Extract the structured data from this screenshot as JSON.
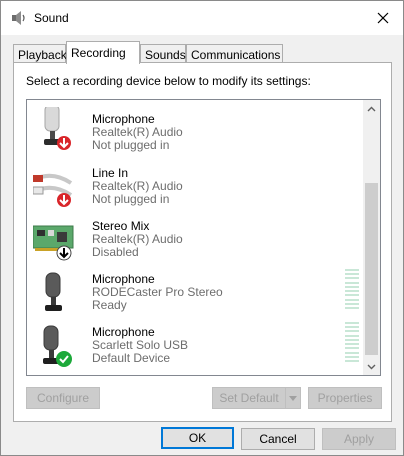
{
  "window": {
    "title": "Sound",
    "title_icon": "speaker-icon",
    "close_icon": "close-icon"
  },
  "tabs": [
    {
      "label": "Playback",
      "active": false
    },
    {
      "label": "Recording",
      "active": true
    },
    {
      "label": "Sounds",
      "active": false
    },
    {
      "label": "Communications",
      "active": false
    }
  ],
  "instruction": "Select a recording device below to modify its settings:",
  "devices": [
    {
      "name": "Microphone",
      "driver": "Realtek(R) Audio",
      "status": "Not plugged in",
      "icon": "microphone-icon",
      "badge": "red-down-arrow"
    },
    {
      "name": "Line In",
      "driver": "Realtek(R) Audio",
      "status": "Not plugged in",
      "icon": "line-in-cable-icon",
      "badge": "red-down-arrow"
    },
    {
      "name": "Stereo Mix",
      "driver": "Realtek(R) Audio",
      "status": "Disabled",
      "icon": "sound-card-icon",
      "badge": "black-down-arrow"
    },
    {
      "name": "Microphone",
      "driver": "RODECaster Pro Stereo",
      "status": "Ready",
      "icon": "microphone-icon",
      "badge": "none"
    },
    {
      "name": "Microphone",
      "driver": "Scarlett Solo USB",
      "status": "Default Device",
      "icon": "microphone-icon",
      "badge": "green-check"
    }
  ],
  "buttons": {
    "configure": "Configure",
    "set_default": "Set Default",
    "properties": "Properties",
    "ok": "OK",
    "cancel": "Cancel",
    "apply": "Apply"
  },
  "colors": {
    "accent": "#0078d7",
    "meter": "#c9e7d7",
    "badge_red": "#d9252a",
    "badge_green": "#1ca93a"
  }
}
